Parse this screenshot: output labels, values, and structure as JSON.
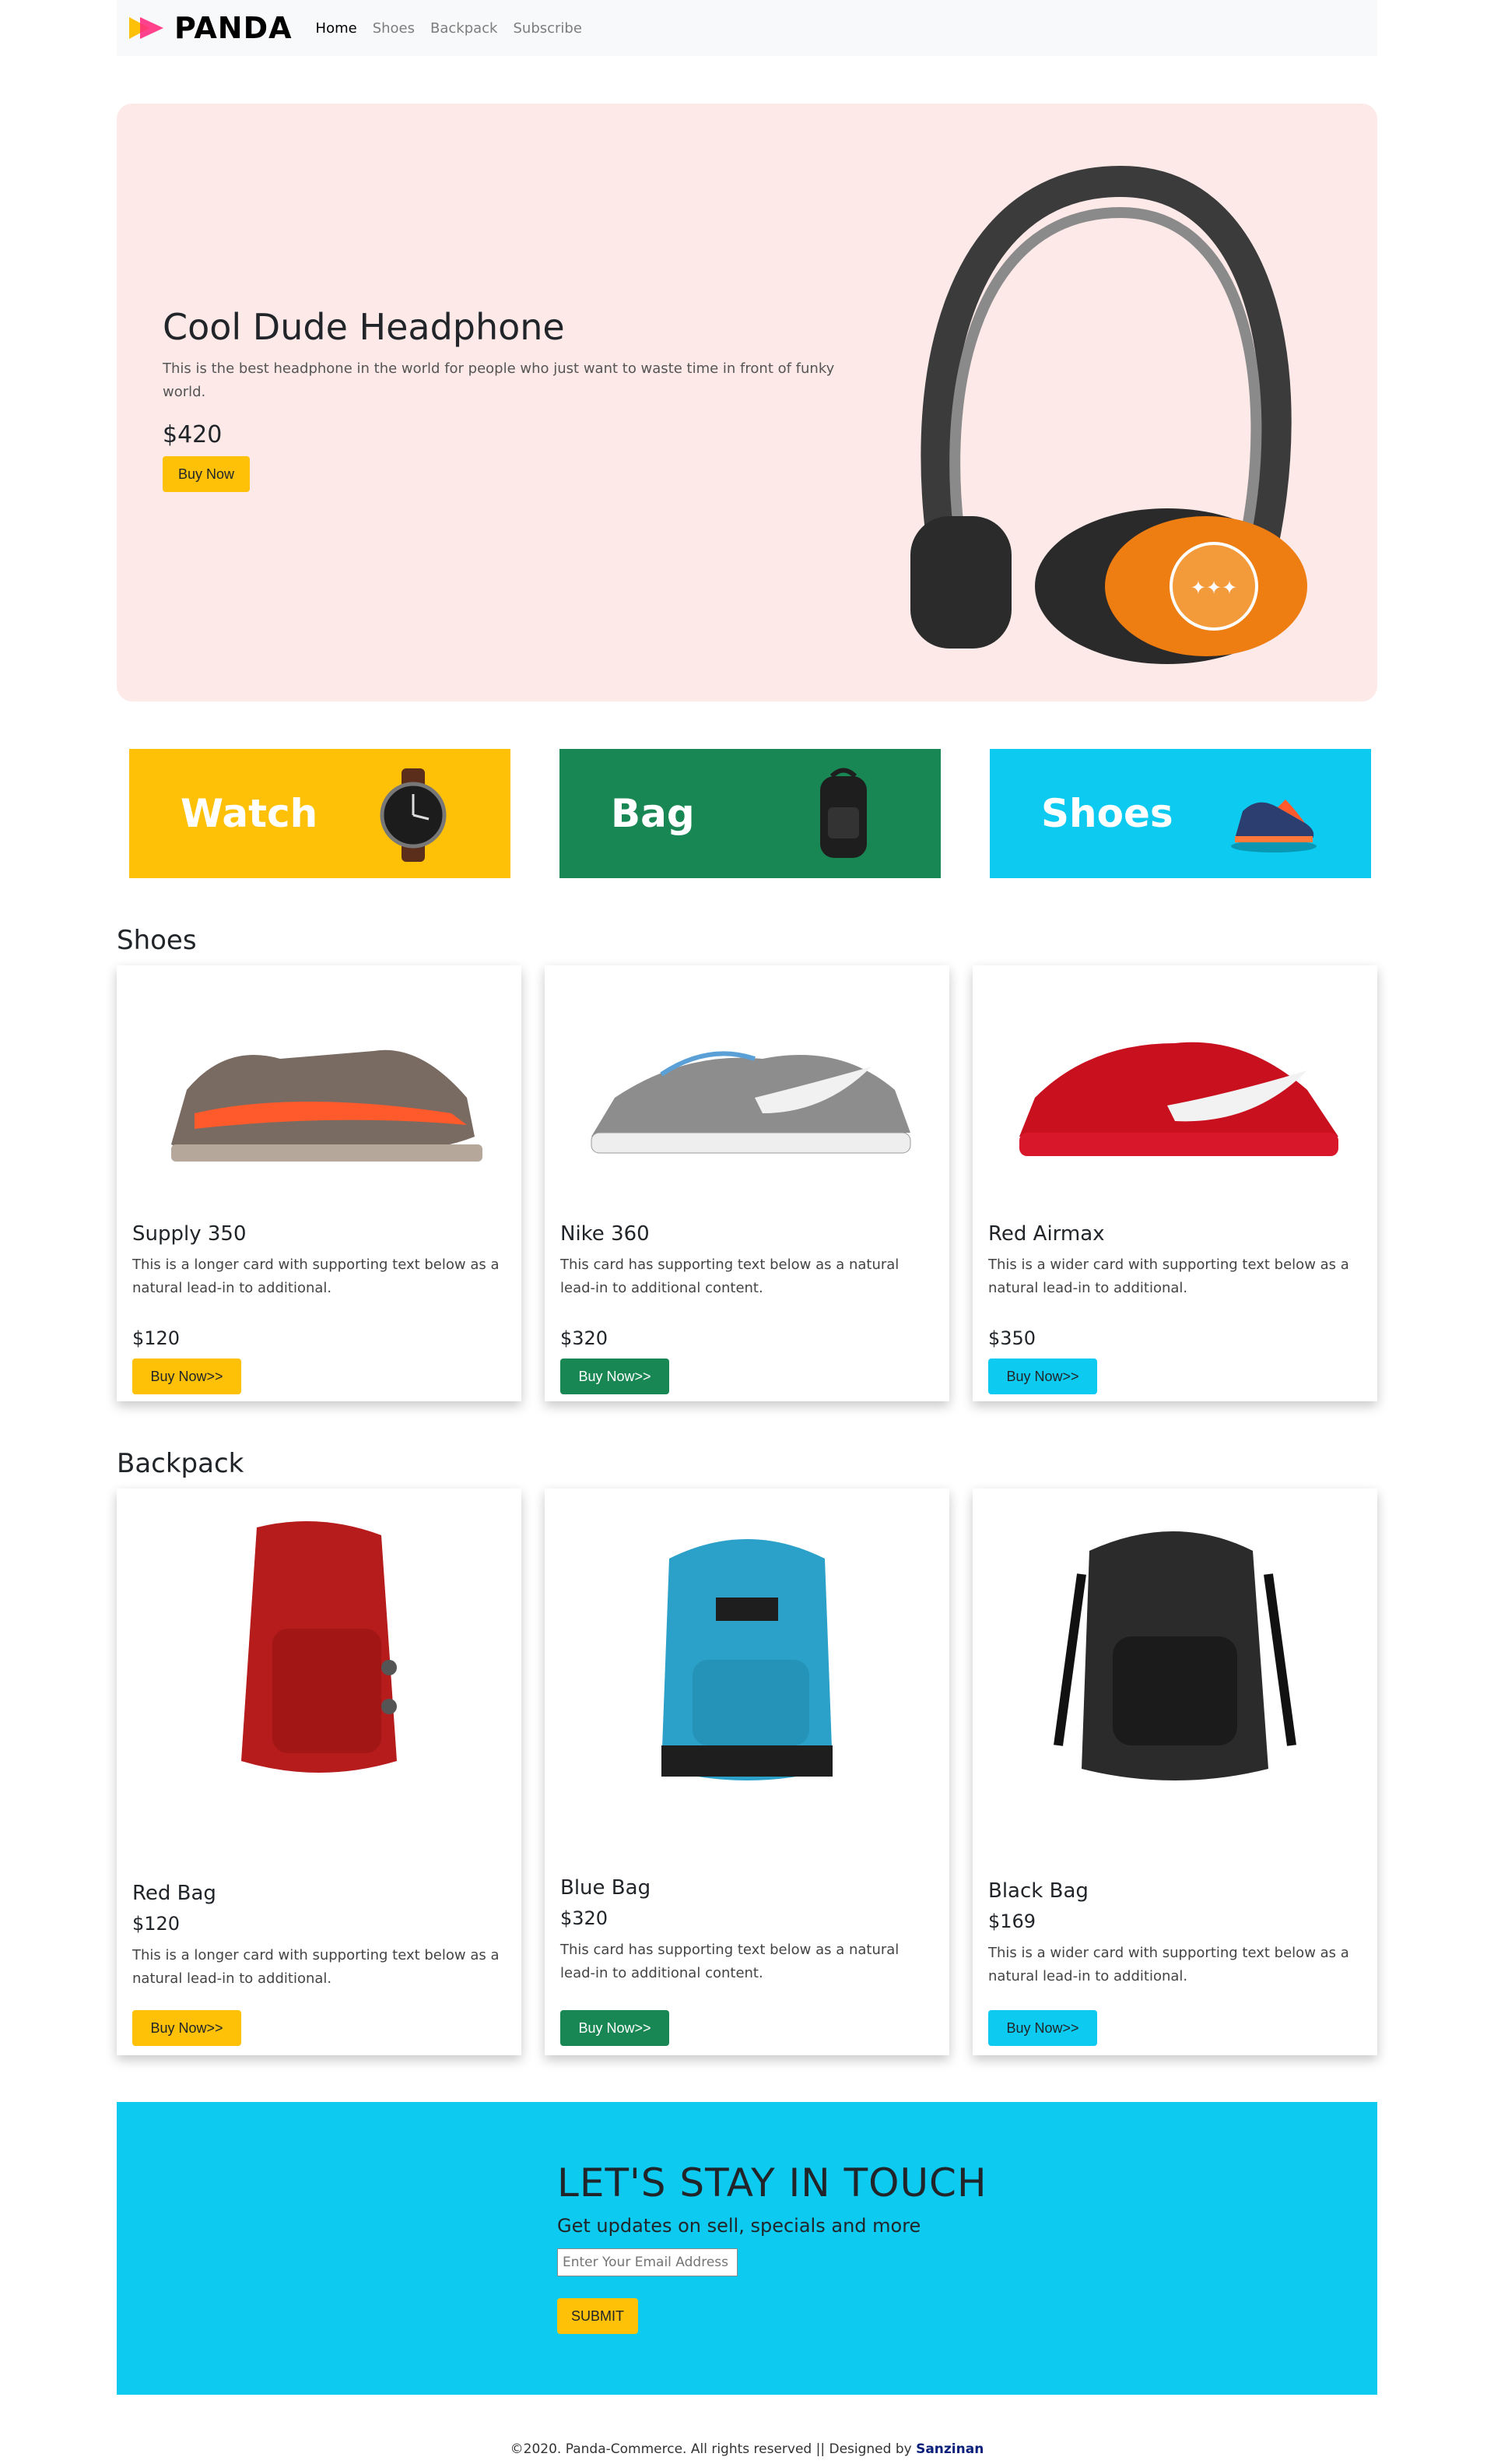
{
  "navbar": {
    "brand": "PANDA",
    "links": [
      "Home",
      "Shoes",
      "Backpack",
      "Subscribe"
    ]
  },
  "hero": {
    "title": "Cool Dude Headphone",
    "description": "This is the best headphone in the world for people who just want to waste time in front of funky world.",
    "price": "$420",
    "button": "Buy Now"
  },
  "categories": [
    {
      "label": "Watch",
      "color": "#ffc107"
    },
    {
      "label": "Bag",
      "color": "#198754"
    },
    {
      "label": "Shoes",
      "color": "#0dcaf0"
    }
  ],
  "shoes": {
    "heading": "Shoes",
    "items": [
      {
        "title": "Supply 350",
        "text": "This is a longer card with supporting text below as a natural lead-in to additional.",
        "price": "$120",
        "button": "Buy Now>>"
      },
      {
        "title": "Nike 360",
        "text": "This card has supporting text below as a natural lead-in to additional content.",
        "price": "$320",
        "button": "Buy Now>>"
      },
      {
        "title": "Red Airmax",
        "text": "This is a wider card with supporting text below as a natural lead-in to additional.",
        "price": "$350",
        "button": "Buy Now>>"
      }
    ]
  },
  "backpack": {
    "heading": "Backpack",
    "items": [
      {
        "title": "Red Bag",
        "price": "$120",
        "text": "This is a longer card with supporting text below as a natural lead-in to additional.",
        "button": "Buy Now>>"
      },
      {
        "title": "Blue Bag",
        "price": "$320",
        "text": "This card has supporting text below as a natural lead-in to additional content.",
        "button": "Buy Now>>"
      },
      {
        "title": "Black Bag",
        "price": "$169",
        "text": "This is a wider card with supporting text below as a natural lead-in to additional.",
        "button": "Buy Now>>"
      }
    ]
  },
  "subscribe": {
    "title": "LET'S STAY IN TOUCH",
    "subtitle": "Get updates on sell, specials and more",
    "placeholder": "Enter Your Email Address",
    "button": "SUBMIT"
  },
  "footer": {
    "text": "©2020. Panda-Commerce. All rights reserved || Designed by ",
    "designer": "Sanzinan"
  }
}
